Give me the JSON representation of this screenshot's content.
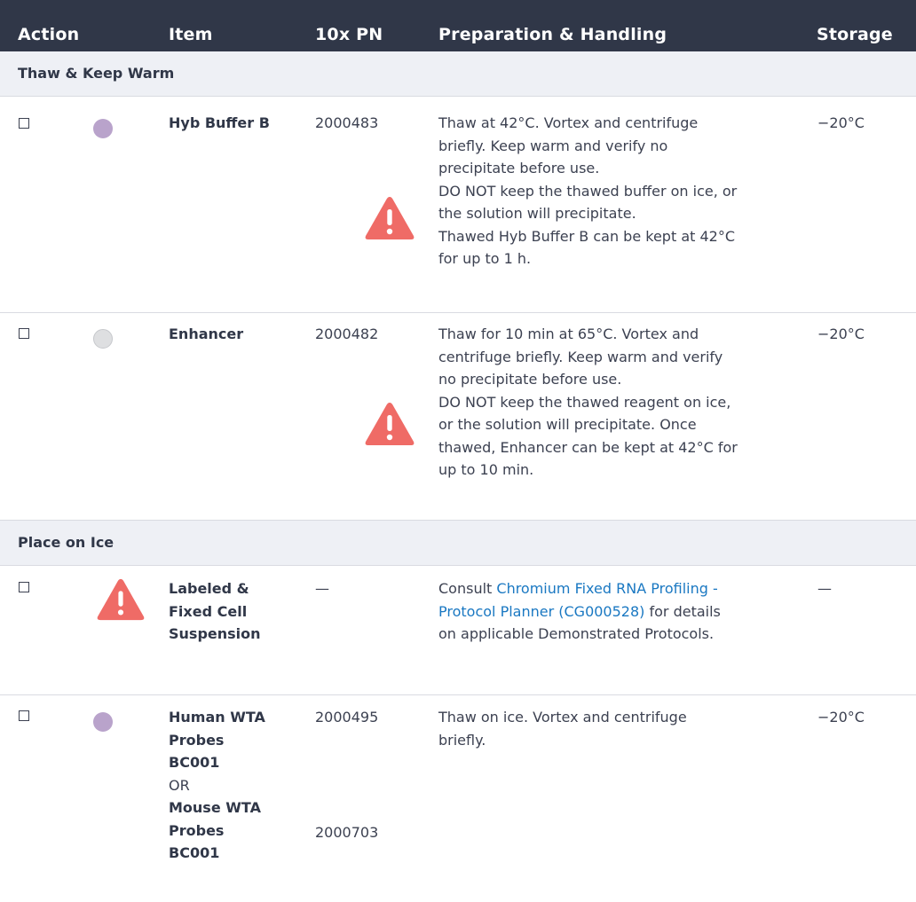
{
  "header": {
    "action": "Action",
    "item": "Item",
    "pn": "10x PN",
    "prep": "Preparation & Handling",
    "storage": "Storage"
  },
  "colors": {
    "header_bg": "#303748",
    "section_bg": "#eef0f5",
    "warning": "#ef6b66",
    "link": "#1a78c2",
    "purple_dot": "#b9a3cb",
    "grey_dot": "#dedfe1"
  },
  "sections": [
    {
      "title": "Thaw & Keep Warm",
      "rows": [
        {
          "icon": "purple-dot",
          "item": "Hyb Buffer B",
          "pn": "2000483",
          "prep": [
            "Thaw at 42°C. Vortex and centrifuge",
            "briefly. Keep warm and verify no",
            "precipitate before use.",
            "DO NOT keep the thawed buffer on ice, or",
            "the solution will precipitate.",
            "Thawed Hyb Buffer B can be kept at 42°C",
            "for up to 1 h."
          ],
          "storage": "−20°C",
          "warning_icon": "warning-triangle-icon"
        },
        {
          "icon": "grey-dot",
          "item": "Enhancer",
          "pn": "2000482",
          "prep": [
            "Thaw for 10 min at 65°C. Vortex and",
            "centrifuge briefly. Keep warm and verify",
            "no precipitate before use.",
            "DO NOT keep the thawed reagent on ice,",
            "or the solution will precipitate. Once",
            "thawed, Enhancer can be kept at 42°C for",
            "up to 10 min."
          ],
          "storage": "−20°C",
          "warning_icon": "warning-triangle-icon"
        }
      ]
    },
    {
      "title": "Place on Ice",
      "rows": [
        {
          "icon": "warning-triangle-icon",
          "item": [
            "Labeled &",
            "Fixed Cell",
            "Suspension"
          ],
          "pn": "—",
          "prep_pre": "Consult ",
          "prep_link": [
            "Chromium Fixed RNA Profiling -",
            "Protocol Planner (CG000528)"
          ],
          "prep_post": [
            " for details",
            "on applicable Demonstrated Protocols."
          ],
          "storage": "—"
        },
        {
          "icon": "purple-dot",
          "item_a": [
            "Human WTA",
            "Probes",
            "BC001"
          ],
          "or": "OR",
          "item_b": [
            "Mouse WTA",
            "Probes",
            "BC001"
          ],
          "pn_a": "2000495",
          "pn_b": "2000703",
          "prep": [
            "Thaw on ice. Vortex and centrifuge",
            "briefly."
          ],
          "storage": "−20°C"
        }
      ]
    }
  ]
}
